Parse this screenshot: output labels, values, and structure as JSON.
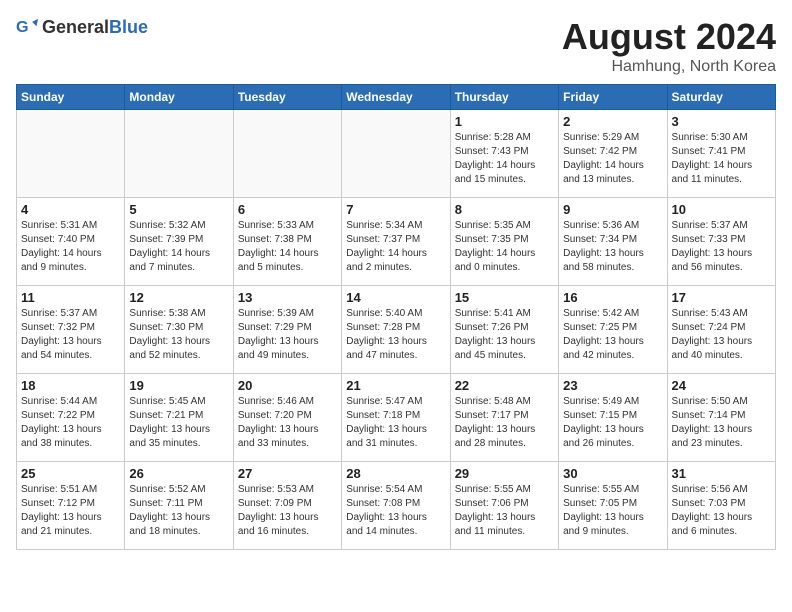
{
  "header": {
    "logo_general": "General",
    "logo_blue": "Blue",
    "month_year": "August 2024",
    "location": "Hamhung, North Korea"
  },
  "weekdays": [
    "Sunday",
    "Monday",
    "Tuesday",
    "Wednesday",
    "Thursday",
    "Friday",
    "Saturday"
  ],
  "weeks": [
    [
      {
        "day": "",
        "empty": true
      },
      {
        "day": "",
        "empty": true
      },
      {
        "day": "",
        "empty": true
      },
      {
        "day": "",
        "empty": true
      },
      {
        "day": "1",
        "sunrise": "5:28 AM",
        "sunset": "7:43 PM",
        "daylight": "14 hours and 15 minutes."
      },
      {
        "day": "2",
        "sunrise": "5:29 AM",
        "sunset": "7:42 PM",
        "daylight": "14 hours and 13 minutes."
      },
      {
        "day": "3",
        "sunrise": "5:30 AM",
        "sunset": "7:41 PM",
        "daylight": "14 hours and 11 minutes."
      }
    ],
    [
      {
        "day": "4",
        "sunrise": "5:31 AM",
        "sunset": "7:40 PM",
        "daylight": "14 hours and 9 minutes."
      },
      {
        "day": "5",
        "sunrise": "5:32 AM",
        "sunset": "7:39 PM",
        "daylight": "14 hours and 7 minutes."
      },
      {
        "day": "6",
        "sunrise": "5:33 AM",
        "sunset": "7:38 PM",
        "daylight": "14 hours and 5 minutes."
      },
      {
        "day": "7",
        "sunrise": "5:34 AM",
        "sunset": "7:37 PM",
        "daylight": "14 hours and 2 minutes."
      },
      {
        "day": "8",
        "sunrise": "5:35 AM",
        "sunset": "7:35 PM",
        "daylight": "14 hours and 0 minutes."
      },
      {
        "day": "9",
        "sunrise": "5:36 AM",
        "sunset": "7:34 PM",
        "daylight": "13 hours and 58 minutes."
      },
      {
        "day": "10",
        "sunrise": "5:37 AM",
        "sunset": "7:33 PM",
        "daylight": "13 hours and 56 minutes."
      }
    ],
    [
      {
        "day": "11",
        "sunrise": "5:37 AM",
        "sunset": "7:32 PM",
        "daylight": "13 hours and 54 minutes."
      },
      {
        "day": "12",
        "sunrise": "5:38 AM",
        "sunset": "7:30 PM",
        "daylight": "13 hours and 52 minutes."
      },
      {
        "day": "13",
        "sunrise": "5:39 AM",
        "sunset": "7:29 PM",
        "daylight": "13 hours and 49 minutes."
      },
      {
        "day": "14",
        "sunrise": "5:40 AM",
        "sunset": "7:28 PM",
        "daylight": "13 hours and 47 minutes."
      },
      {
        "day": "15",
        "sunrise": "5:41 AM",
        "sunset": "7:26 PM",
        "daylight": "13 hours and 45 minutes."
      },
      {
        "day": "16",
        "sunrise": "5:42 AM",
        "sunset": "7:25 PM",
        "daylight": "13 hours and 42 minutes."
      },
      {
        "day": "17",
        "sunrise": "5:43 AM",
        "sunset": "7:24 PM",
        "daylight": "13 hours and 40 minutes."
      }
    ],
    [
      {
        "day": "18",
        "sunrise": "5:44 AM",
        "sunset": "7:22 PM",
        "daylight": "13 hours and 38 minutes."
      },
      {
        "day": "19",
        "sunrise": "5:45 AM",
        "sunset": "7:21 PM",
        "daylight": "13 hours and 35 minutes."
      },
      {
        "day": "20",
        "sunrise": "5:46 AM",
        "sunset": "7:20 PM",
        "daylight": "13 hours and 33 minutes."
      },
      {
        "day": "21",
        "sunrise": "5:47 AM",
        "sunset": "7:18 PM",
        "daylight": "13 hours and 31 minutes."
      },
      {
        "day": "22",
        "sunrise": "5:48 AM",
        "sunset": "7:17 PM",
        "daylight": "13 hours and 28 minutes."
      },
      {
        "day": "23",
        "sunrise": "5:49 AM",
        "sunset": "7:15 PM",
        "daylight": "13 hours and 26 minutes."
      },
      {
        "day": "24",
        "sunrise": "5:50 AM",
        "sunset": "7:14 PM",
        "daylight": "13 hours and 23 minutes."
      }
    ],
    [
      {
        "day": "25",
        "sunrise": "5:51 AM",
        "sunset": "7:12 PM",
        "daylight": "13 hours and 21 minutes."
      },
      {
        "day": "26",
        "sunrise": "5:52 AM",
        "sunset": "7:11 PM",
        "daylight": "13 hours and 18 minutes."
      },
      {
        "day": "27",
        "sunrise": "5:53 AM",
        "sunset": "7:09 PM",
        "daylight": "13 hours and 16 minutes."
      },
      {
        "day": "28",
        "sunrise": "5:54 AM",
        "sunset": "7:08 PM",
        "daylight": "13 hours and 14 minutes."
      },
      {
        "day": "29",
        "sunrise": "5:55 AM",
        "sunset": "7:06 PM",
        "daylight": "13 hours and 11 minutes."
      },
      {
        "day": "30",
        "sunrise": "5:55 AM",
        "sunset": "7:05 PM",
        "daylight": "13 hours and 9 minutes."
      },
      {
        "day": "31",
        "sunrise": "5:56 AM",
        "sunset": "7:03 PM",
        "daylight": "13 hours and 6 minutes."
      }
    ]
  ]
}
